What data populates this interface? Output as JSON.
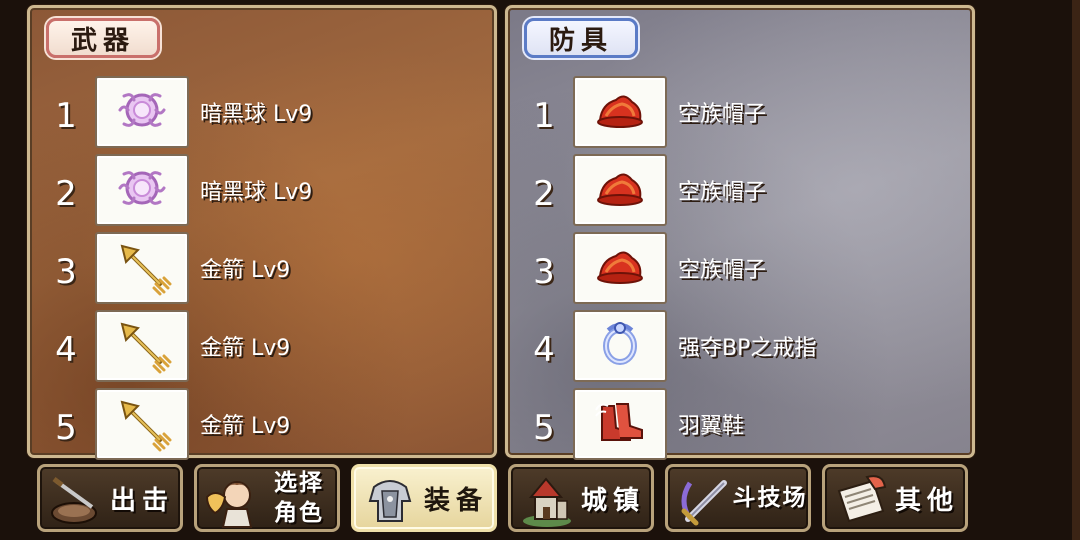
{
  "weapons": {
    "title": "武器",
    "items": [
      {
        "num": "1",
        "name": "暗黑球 Lv9",
        "icon": "dark-orb-icon"
      },
      {
        "num": "2",
        "name": "暗黑球 Lv9",
        "icon": "dark-orb-icon"
      },
      {
        "num": "3",
        "name": "金箭 Lv9",
        "icon": "gold-arrow-icon"
      },
      {
        "num": "4",
        "name": "金箭 Lv9",
        "icon": "gold-arrow-icon"
      },
      {
        "num": "5",
        "name": "金箭 Lv9",
        "icon": "gold-arrow-icon"
      }
    ]
  },
  "armor": {
    "title": "防具",
    "items": [
      {
        "num": "1",
        "name": "空族帽子",
        "icon": "red-hat-icon"
      },
      {
        "num": "2",
        "name": "空族帽子",
        "icon": "red-hat-icon"
      },
      {
        "num": "3",
        "name": "空族帽子",
        "icon": "red-hat-icon"
      },
      {
        "num": "4",
        "name": "强夺BP之戒指",
        "icon": "ring-icon"
      },
      {
        "num": "5",
        "name": "羽翼鞋",
        "icon": "winged-shoes-icon"
      }
    ]
  },
  "nav": {
    "buttons": [
      {
        "label": "出击",
        "icon": "sortie-icon",
        "active": false
      },
      {
        "label": "选择\n角色",
        "icon": "character-select-icon",
        "active": false
      },
      {
        "label": "装备",
        "icon": "armor-icon",
        "active": true
      },
      {
        "label": "城镇",
        "icon": "town-icon",
        "active": false
      },
      {
        "label": "斗技场",
        "icon": "arena-sword-icon",
        "active": false
      },
      {
        "label": "其他",
        "icon": "scroll-icon",
        "active": false
      }
    ]
  }
}
